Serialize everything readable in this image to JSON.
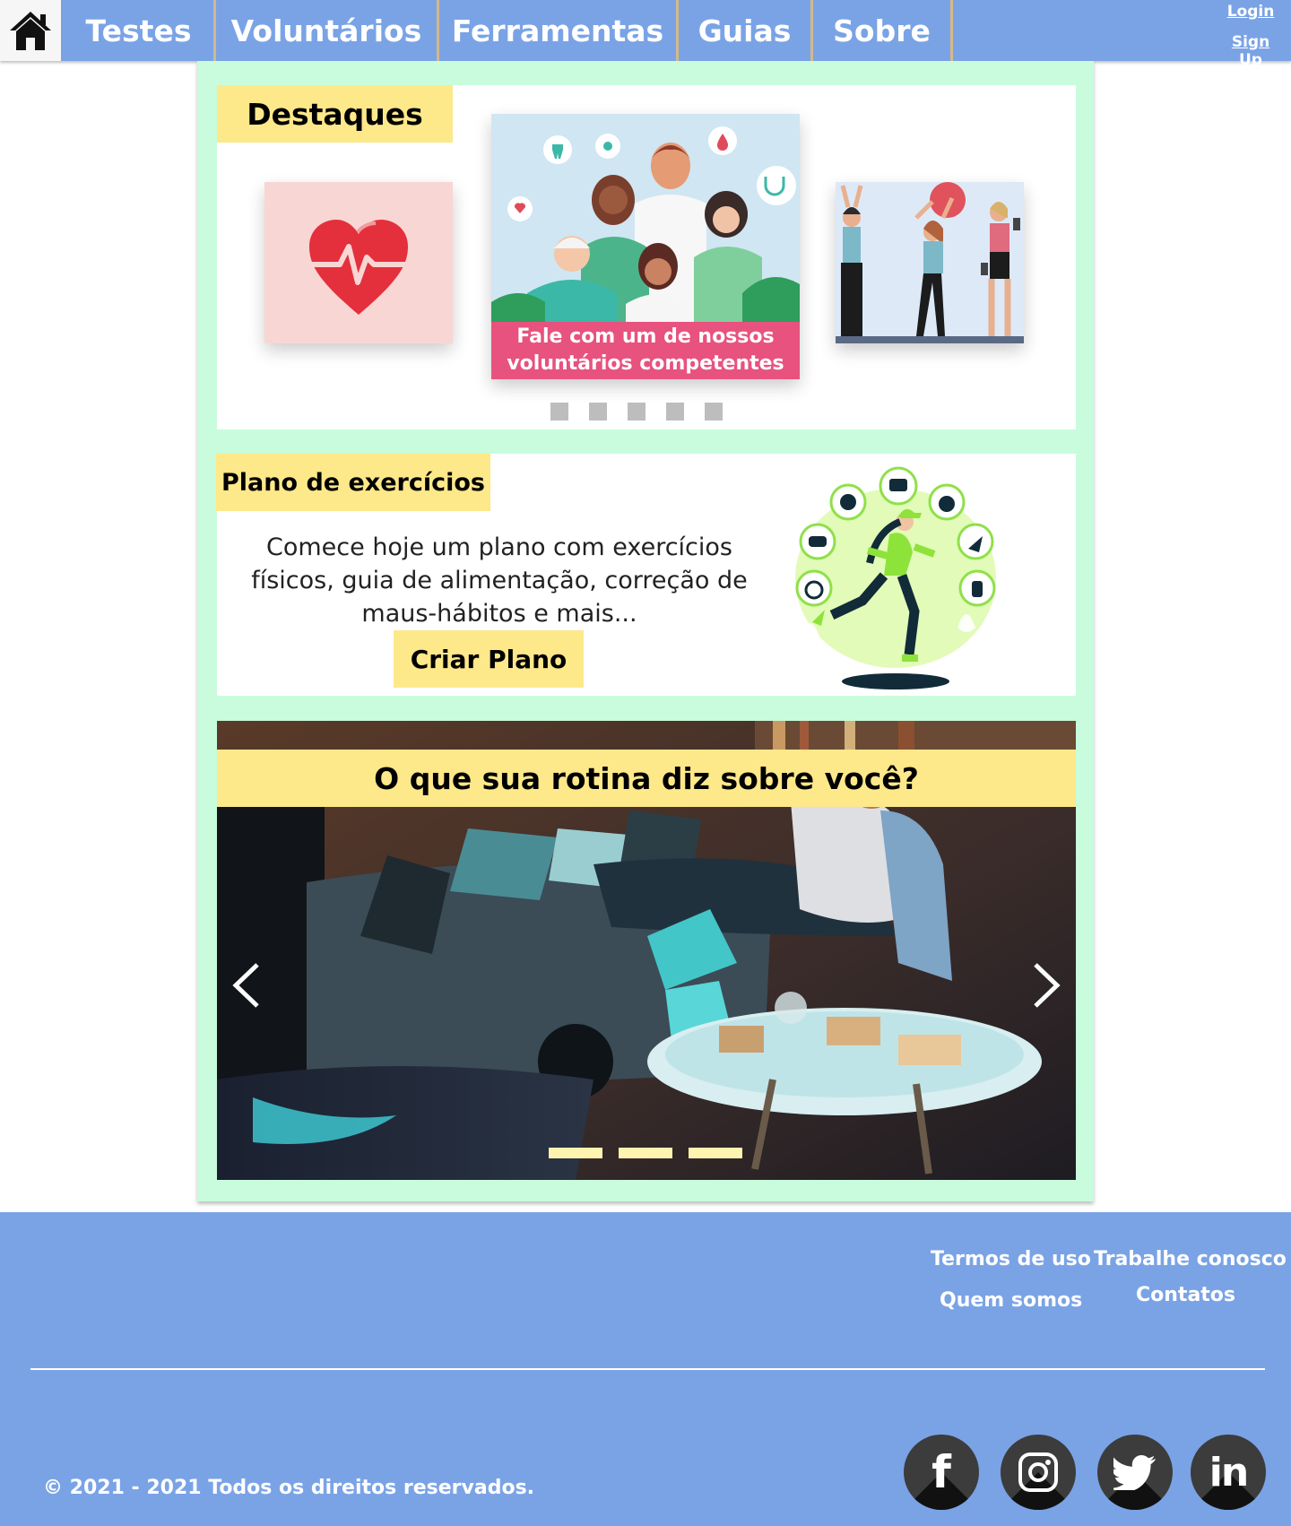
{
  "nav": {
    "items": [
      {
        "label": "Testes"
      },
      {
        "label": "Voluntários"
      },
      {
        "label": "Ferramentas"
      },
      {
        "label": "Guias"
      },
      {
        "label": "Sobre"
      }
    ],
    "login": "Login",
    "signup": "Sign Up"
  },
  "destaques": {
    "title": "Destaques",
    "featured_caption_line1": "Fale com um de nossos",
    "featured_caption_line2": "voluntários competentes",
    "dot_count": 5
  },
  "plano": {
    "title": "Plano de exercícios",
    "description": "Comece hoje um plano com exercícios físicos, guia de alimentação, correção de maus-hábitos e mais...",
    "button": "Criar Plano"
  },
  "rotina": {
    "title": "O que sua rotina diz sobre você?",
    "slide_count": 3
  },
  "footer": {
    "links": {
      "terms": "Termos de uso",
      "work": "Trabalhe conosco",
      "about": "Quem somos",
      "contacts": "Contatos"
    },
    "copyright": "© 2021 - 2021 Todos os direitos reservados.",
    "social": [
      "facebook",
      "instagram",
      "twitter",
      "linkedin"
    ]
  },
  "colors": {
    "nav_bg": "#7aa3e6",
    "frame_bg": "#c8fcdc",
    "tag_yellow": "#fde88a",
    "caption_pink": "#e8527e"
  }
}
